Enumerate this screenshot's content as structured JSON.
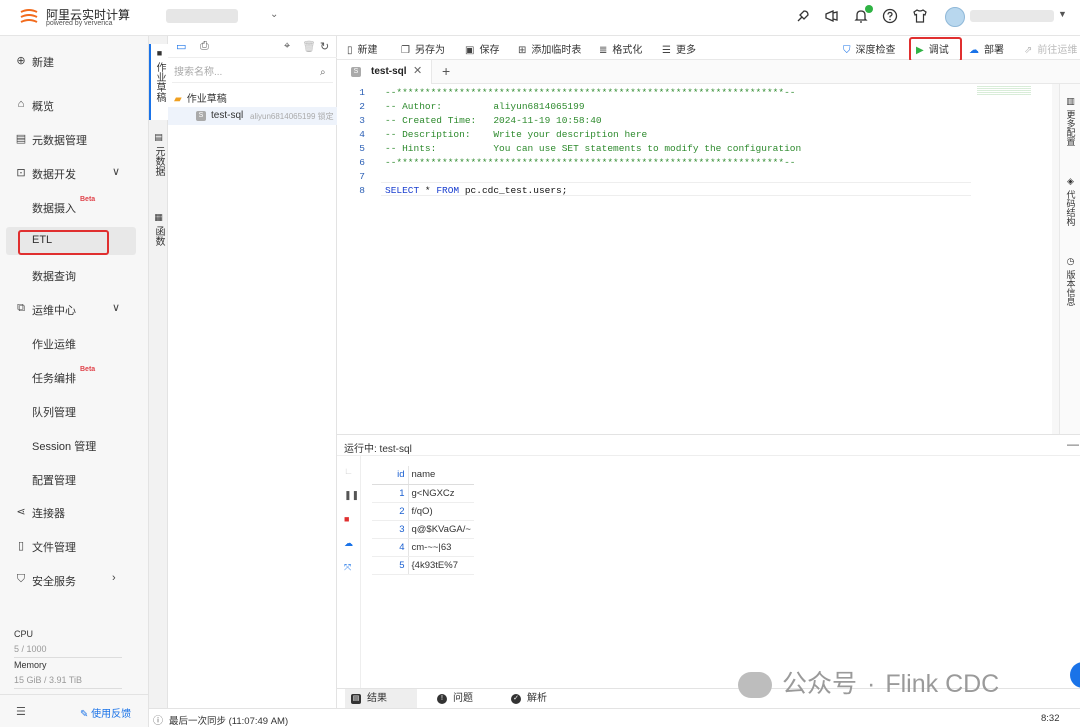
{
  "topbar": {
    "brand_name": "阿里云实时计算",
    "brand_sub": "powered by ververica",
    "icons": [
      "rocket-icon",
      "megaphone-icon",
      "bell-icon",
      "help-icon",
      "shirt-icon",
      "avatar"
    ]
  },
  "sidebar": {
    "new_label": "新建",
    "items": [
      {
        "label": "概览",
        "icon": "home-icon"
      },
      {
        "label": "元数据管理",
        "icon": "database-icon"
      },
      {
        "label": "数据开发",
        "icon": "code-icon"
      },
      {
        "label": "数据摄入",
        "badge": "Beta"
      },
      {
        "label": "ETL"
      },
      {
        "label": "数据查询"
      },
      {
        "label": "运维中心",
        "icon": "ops-icon"
      },
      {
        "label": "作业运维"
      },
      {
        "label": "任务编排",
        "badge": "Beta"
      },
      {
        "label": "队列管理"
      },
      {
        "label": "Session 管理"
      },
      {
        "label": "配置管理"
      },
      {
        "label": "连接器",
        "icon": "connector-icon"
      },
      {
        "label": "文件管理",
        "icon": "file-icon"
      },
      {
        "label": "安全服务",
        "icon": "shield-icon"
      }
    ],
    "cpu_label": "CPU",
    "cpu_value": "5 / 1000",
    "memory_label": "Memory",
    "memory_value": "15 GiB / 3.91 TiB",
    "feedback": "使用反馈"
  },
  "vtabs": [
    "作业草稿",
    "元数据",
    "函数"
  ],
  "filepanel": {
    "search_placeholder": "搜索名称...",
    "folder": "作业草稿",
    "file_name": "test-sql",
    "file_owner": "aliyun6814065199 锁定"
  },
  "toolbar": {
    "new": "新建",
    "save_as": "另存为",
    "save": "保存",
    "add_temp_table": "添加临时表",
    "format": "格式化",
    "more": "更多",
    "deep_check": "深度检查",
    "debug": "调试",
    "deploy": "部署",
    "goto_ops": "前往运维"
  },
  "editor": {
    "tab": "test-sql",
    "lines": [
      {
        "n": "1",
        "text": "--********************************************************************--",
        "cls": "cmt"
      },
      {
        "n": "2",
        "text": "-- Author:         aliyun6814065199",
        "cls": "cmt"
      },
      {
        "n": "3",
        "text": "-- Created Time:   2024-11-19 10:58:40",
        "cls": "cmt"
      },
      {
        "n": "4",
        "text": "-- Description:    Write your description here",
        "cls": "cmt"
      },
      {
        "n": "5",
        "text": "-- Hints:          You can use SET statements to modify the configuration",
        "cls": "cmt"
      },
      {
        "n": "6",
        "text": "--********************************************************************--",
        "cls": "cmt"
      },
      {
        "n": "7",
        "text": "",
        "cls": "plain"
      },
      {
        "n": "8",
        "text": "SELECT * FROM pc.cdc_test.users;",
        "cls": "sql"
      }
    ]
  },
  "right_rail": [
    "更多配置",
    "代码结构",
    "版本信息"
  ],
  "run": {
    "label": "运行中: test-sql",
    "columns": [
      "id",
      "name"
    ],
    "rows": [
      [
        "1",
        "g<NGXCz"
      ],
      [
        "2",
        "f/qO)"
      ],
      [
        "3",
        "q@$KVaGA/~"
      ],
      [
        "4",
        "cm-~~|63"
      ],
      [
        "5",
        "{4k93tE%7"
      ]
    ],
    "tabs": [
      "结果",
      "问题",
      "解析"
    ]
  },
  "status": {
    "sync": "最后一次同步  (11:07:49 AM)",
    "time": "8:32"
  },
  "watermark": {
    "text1": "公众号",
    "sep": "·",
    "text2": "Flink CDC"
  }
}
